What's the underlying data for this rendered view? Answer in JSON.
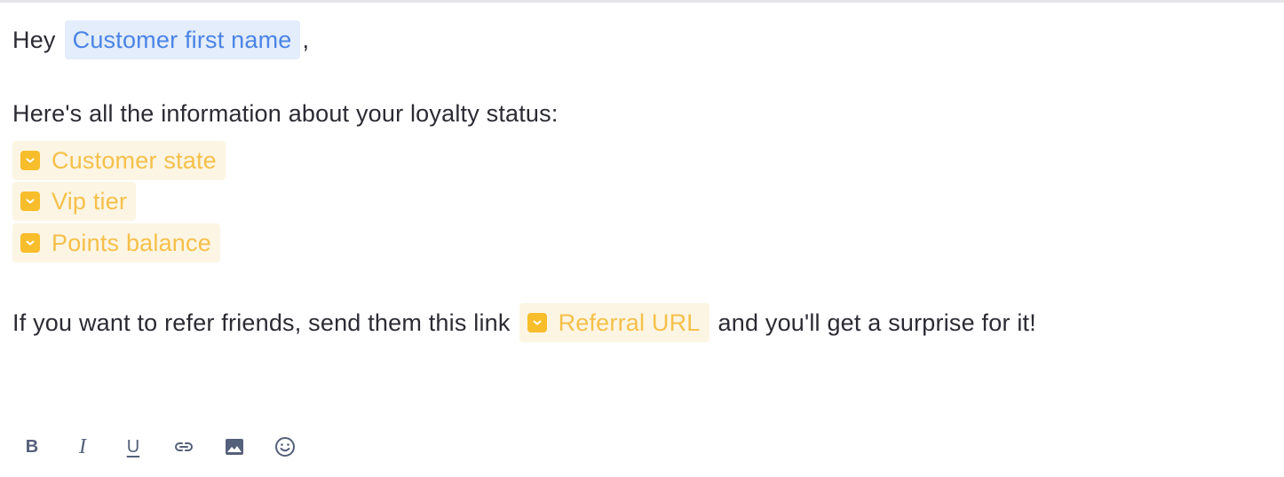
{
  "editor": {
    "greeting": "Hey",
    "customer_first_name": "Customer first name",
    "greeting_comma": ",",
    "intro": "Here's all the information about your loyalty status:",
    "loyalty_vars": [
      {
        "label": "Customer state"
      },
      {
        "label": "Vip tier"
      },
      {
        "label": "Points balance"
      }
    ],
    "referral_prefix": "If you want to refer friends, send them this link",
    "referral_var": "Referral URL",
    "referral_suffix": "and you'll get a surprise for it!"
  },
  "toolbar": {
    "bold_label": "B",
    "italic_label": "I",
    "underline_label": "U",
    "icons": [
      "bold-icon",
      "italic-icon",
      "underline-icon",
      "link-icon",
      "image-icon",
      "emoji-icon"
    ]
  },
  "colors": {
    "text": "#2b2b33",
    "variable_blue": "#4b84e6",
    "variable_blue_bg": "#e3edfb",
    "variable_yellow": "#f5c04a",
    "variable_yellow_bg": "#fdf5e3",
    "toolbar_icon": "#55607a"
  }
}
